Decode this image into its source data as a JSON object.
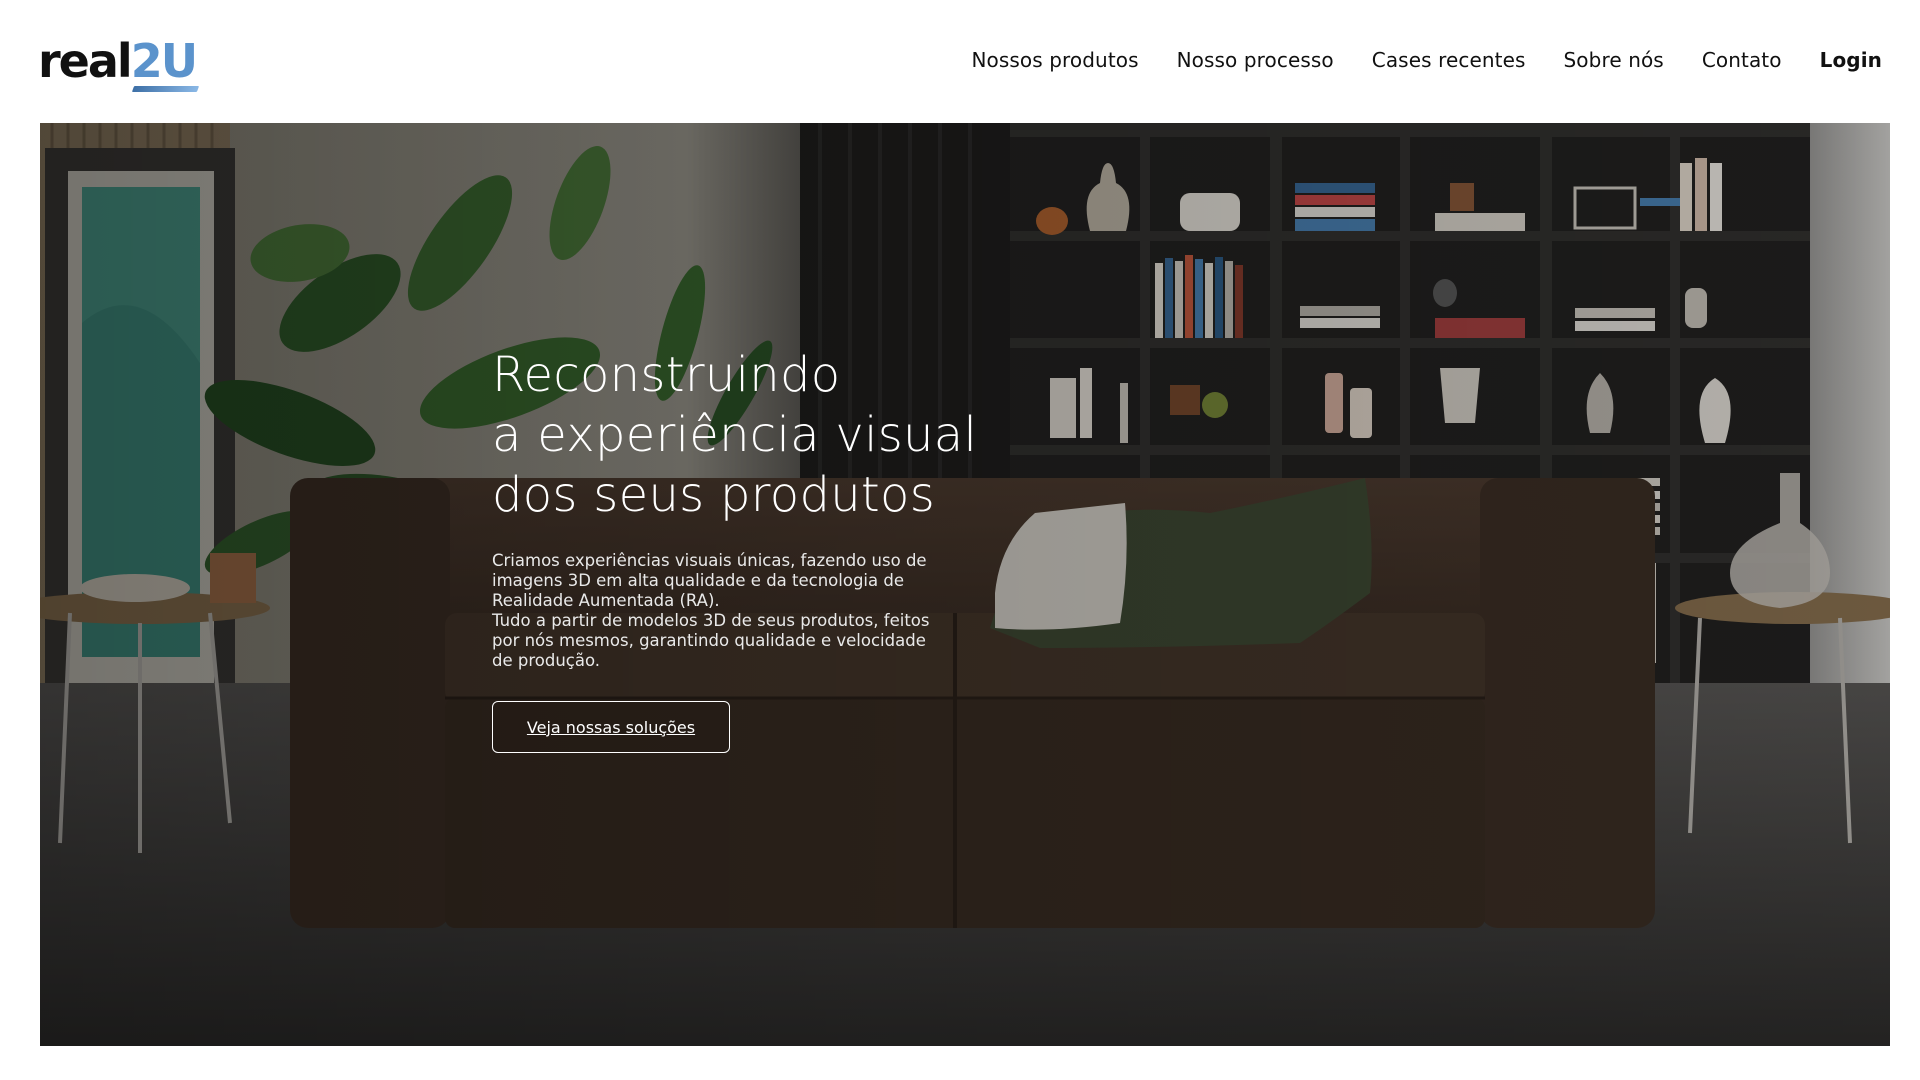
{
  "brand": {
    "logo_part1": "real",
    "logo_part2": "2U",
    "accent_color": "#5b93cc"
  },
  "nav": {
    "items": [
      {
        "label": "Nossos produtos"
      },
      {
        "label": "Nosso processo"
      },
      {
        "label": "Cases recentes"
      },
      {
        "label": "Sobre nós"
      },
      {
        "label": "Contato"
      }
    ],
    "login_label": "Login"
  },
  "hero": {
    "title_lines": [
      "Reconstruindo",
      "a experiência visual",
      "dos seus produtos"
    ],
    "description_lines": [
      "Criamos experiências visuais únicas, fazendo uso de",
      "imagens 3D em alta qualidade e da tecnologia de",
      "Realidade Aumentada (RA).",
      "Tudo a partir de modelos 3D de seus produtos, feitos",
      "por nós mesmos, garantindo qualidade e velocidade",
      "de produção."
    ],
    "cta_label": "Veja nossas soluções",
    "background_scene": "living-room-with-leather-sofa-plants-and-bookshelf"
  }
}
